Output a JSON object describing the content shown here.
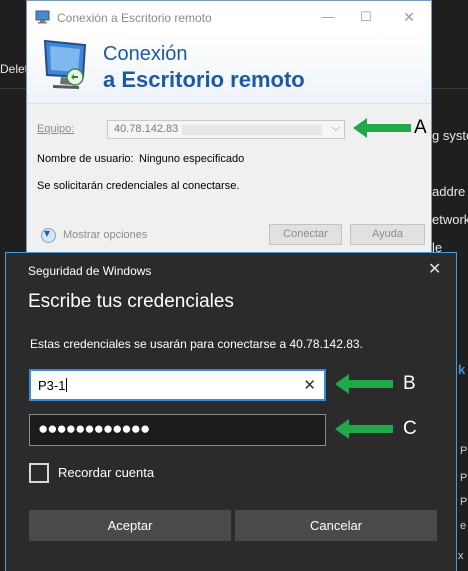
{
  "background": {
    "left_fragment": "Delet",
    "right_fragments": [
      "g syste",
      "addre",
      "etwork",
      "le",
      "k",
      "P",
      "P",
      "P",
      "e",
      "x"
    ]
  },
  "rdp": {
    "title": "Conexión a Escritorio remoto",
    "banner_line1": "Conexión",
    "banner_line2": "a Escritorio remoto",
    "equipo_label": "Equipo:",
    "equipo_value": "40.78.142.83",
    "username_label": "Nombre de usuario:",
    "username_value": "Ninguno especificado",
    "credentials_note": "Se solicitarán credenciales al conectarse.",
    "show_options": "Mostrar opciones",
    "connect_button": "Conectar",
    "help_button": "Ayuda"
  },
  "security": {
    "title": "Seguridad de Windows",
    "heading": "Escribe tus credenciales",
    "message": "Estas credenciales se usarán para conectarse a 40.78.142.83.",
    "username_value": "P3-1",
    "password_mask": "●●●●●●●●●●●●",
    "remember_label": "Recordar cuenta",
    "ok_button": "Aceptar",
    "cancel_button": "Cancelar"
  },
  "annotations": {
    "a": "A",
    "b": "B",
    "c": "C"
  },
  "colors": {
    "arrow": "#21a84a",
    "accent": "#3a8bd7",
    "brand": "#1c5aa6"
  }
}
